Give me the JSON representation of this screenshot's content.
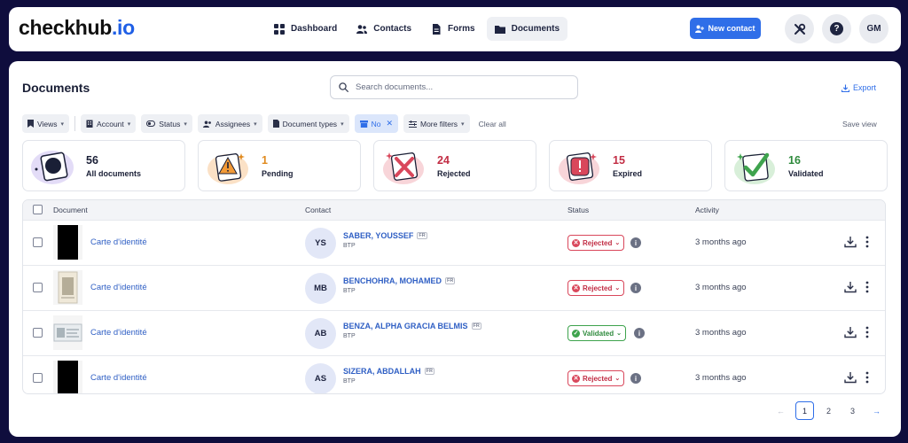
{
  "topbar": {
    "logo_main": "checkhub",
    "logo_suffix": ".io",
    "nav": [
      {
        "label": "Dashboard",
        "icon": "grid-icon"
      },
      {
        "label": "Contacts",
        "icon": "users-icon"
      },
      {
        "label": "Forms",
        "icon": "form-icon"
      },
      {
        "label": "Documents",
        "icon": "folder-icon",
        "active": true
      }
    ],
    "new_contact_label": "New contact",
    "user_initials": "GM"
  },
  "page": {
    "title": "Documents",
    "search_placeholder": "Search documents...",
    "export_label": "Export",
    "save_view_label": "Save view"
  },
  "filters": {
    "views": "Views",
    "account": "Account",
    "status": "Status",
    "assignees": "Assignees",
    "document_types": "Document types",
    "active_filter": "No",
    "more_filters": "More filters",
    "clear_all": "Clear all"
  },
  "cards": [
    {
      "count": "56",
      "label": "All documents",
      "color": "#1a1f36"
    },
    {
      "count": "1",
      "label": "Pending",
      "color": "#e08a1e"
    },
    {
      "count": "24",
      "label": "Rejected",
      "color": "#c22d44"
    },
    {
      "count": "15",
      "label": "Expired",
      "color": "#c22d44"
    },
    {
      "count": "16",
      "label": "Validated",
      "color": "#2e8a3c"
    }
  ],
  "table": {
    "headers": {
      "document": "Document",
      "contact": "Contact",
      "status": "Status",
      "activity": "Activity"
    },
    "rows": [
      {
        "doc": "Carte d'identité",
        "initials": "YS",
        "name": "SABER, YOUSSEF",
        "badge": "FR",
        "sub": "BTP",
        "status": "Rejected",
        "activity": "3 months ago"
      },
      {
        "doc": "Carte d'identité",
        "initials": "MB",
        "name": "BENCHOHRA, MOHAMED",
        "badge": "FR",
        "sub": "BTP",
        "status": "Rejected",
        "activity": "3 months ago"
      },
      {
        "doc": "Carte d'identité",
        "initials": "AB",
        "name": "BENZA, ALPHA GRACIA BELMIS",
        "badge": "FR",
        "sub": "BTP",
        "status": "Validated",
        "activity": "3 months ago"
      },
      {
        "doc": "Carte d'identité",
        "initials": "AS",
        "name": "SIZERA, ABDALLAH",
        "badge": "FR",
        "sub": "BTP",
        "status": "Rejected",
        "activity": "3 months ago"
      }
    ]
  },
  "pagination": {
    "pages": [
      "1",
      "2",
      "3"
    ],
    "current": "1"
  },
  "colors": {
    "accent": "#2f6ee8",
    "rejected": "#c22d44",
    "validated": "#2e8a3c",
    "background": "#0f0d3d"
  }
}
